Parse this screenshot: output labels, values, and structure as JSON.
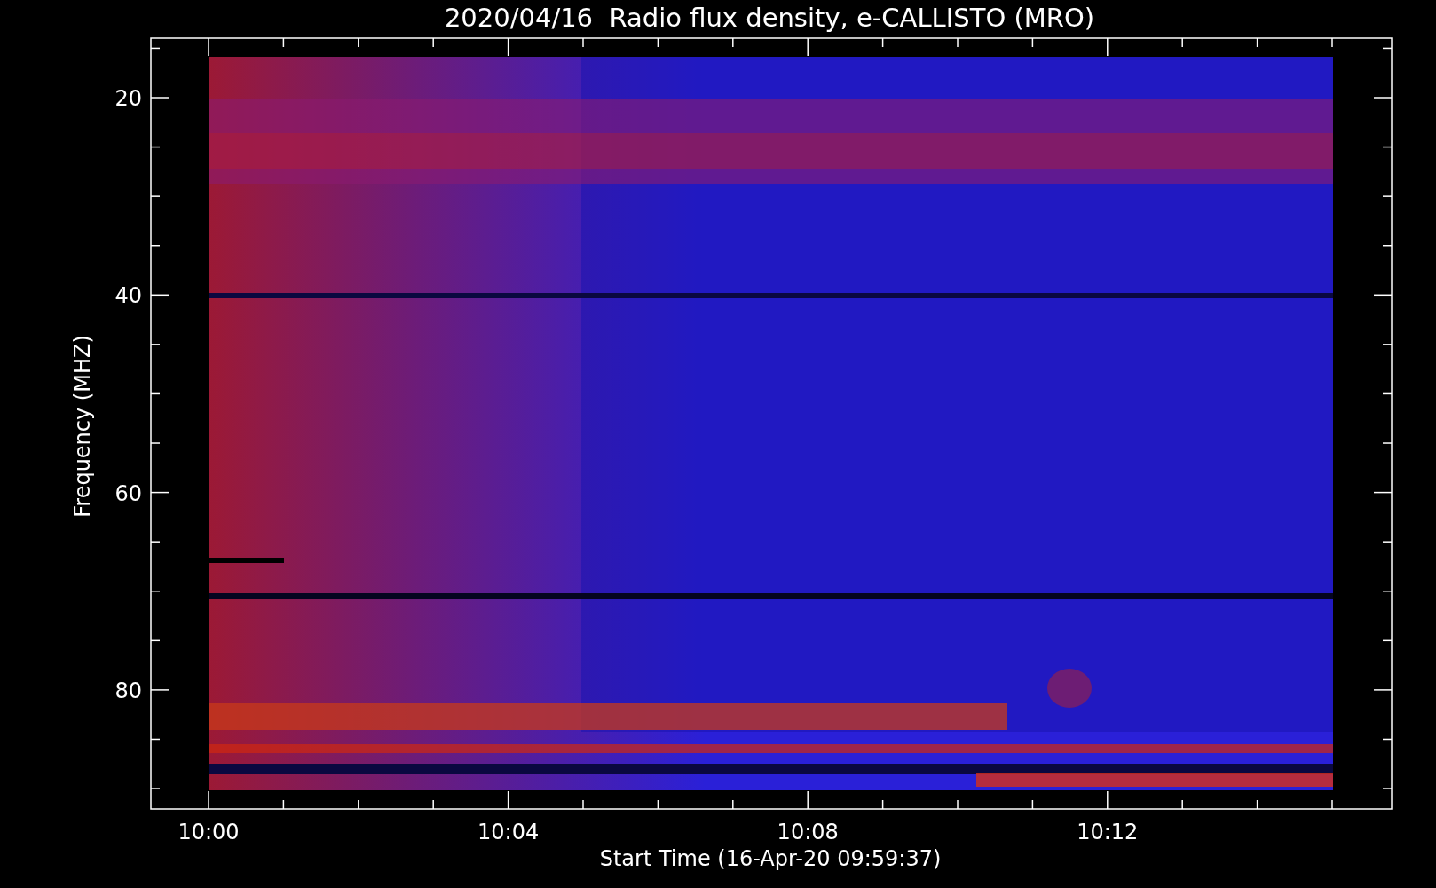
{
  "title": "2020/04/16  Radio flux density, e-CALLISTO (MRO)",
  "y_axis": {
    "label": "Frequency (MHZ)",
    "ticks": [
      "20",
      "40",
      "60",
      "80"
    ]
  },
  "x_axis": {
    "label": "Start Time (16-Apr-20 09:59:37)",
    "ticks": [
      "10:00",
      "10:04",
      "10:08",
      "10:12"
    ]
  }
}
